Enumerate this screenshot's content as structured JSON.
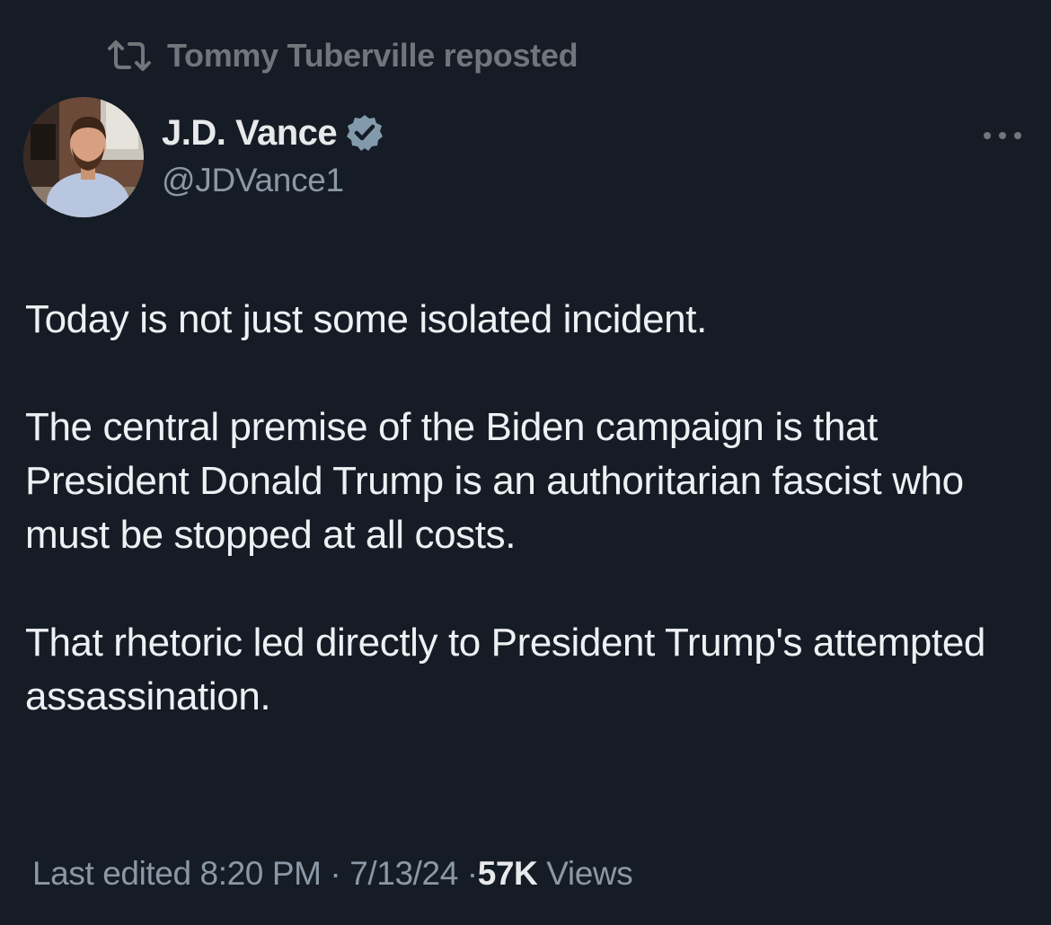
{
  "repost": {
    "icon": "repost-icon",
    "text": "Tommy Tuberville reposted"
  },
  "author": {
    "avatar_icon": "avatar",
    "display_name": "J.D. Vance",
    "verified_icon": "verified-badge-icon",
    "handle": "@JDVance1"
  },
  "menu": {
    "icon": "more-options-icon"
  },
  "tweet": {
    "paragraphs": [
      "Today is not just some isolated incident.",
      "The central premise of the Biden campaign is that President Donald Trump is an authoritarian fascist who must be stopped at all costs.",
      "That rhetoric led directly to President Trump's attempted assassination."
    ]
  },
  "meta": {
    "edited_label": "Last edited",
    "time": "8:20 PM",
    "separator": "·",
    "date": "7/13/24",
    "views_count": "57K",
    "views_label": "Views"
  },
  "colors": {
    "background": "#161c26",
    "text": "#e7e9ea",
    "secondary": "#8b98a5",
    "verified": "#829aab"
  }
}
